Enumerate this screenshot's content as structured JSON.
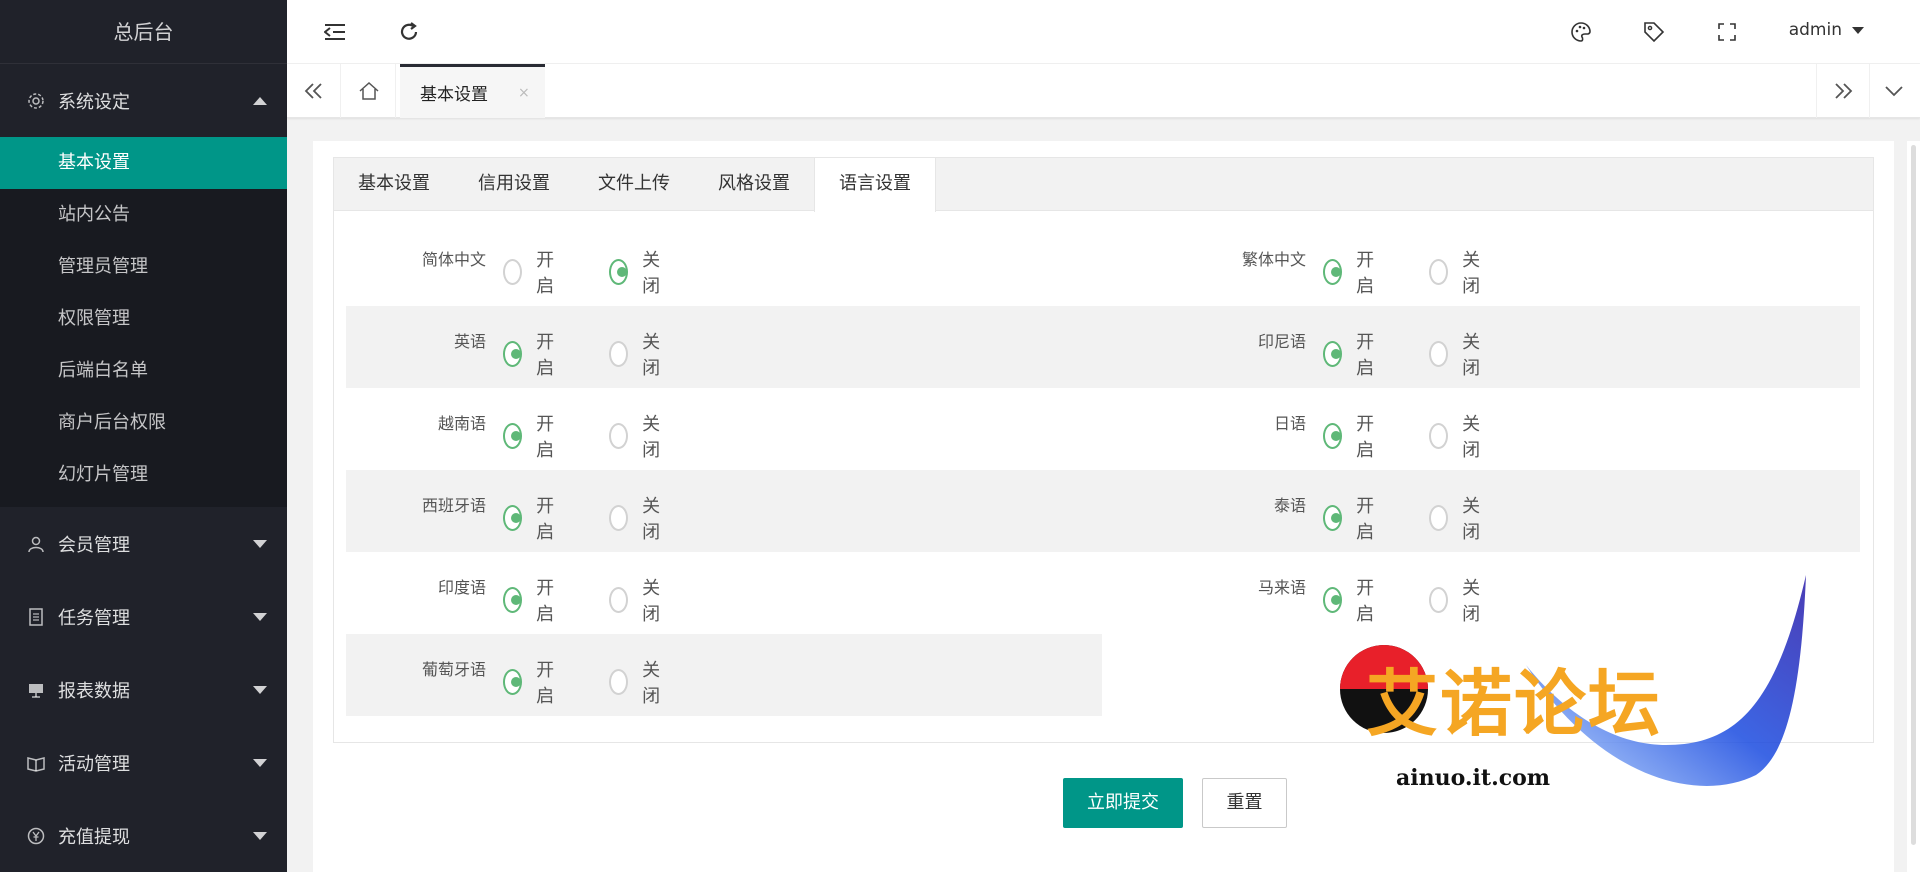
{
  "app": {
    "title": "总后台"
  },
  "sidebar": {
    "groups": [
      {
        "label": "系统设定",
        "icon": "gear-icon",
        "expanded": true,
        "items": [
          {
            "label": "基本设置",
            "active": true
          },
          {
            "label": "站内公告"
          },
          {
            "label": "管理员管理"
          },
          {
            "label": "权限管理"
          },
          {
            "label": "后端白名单"
          },
          {
            "label": "商户后台权限"
          },
          {
            "label": "幻灯片管理"
          }
        ]
      },
      {
        "label": "会员管理",
        "icon": "user-icon"
      },
      {
        "label": "任务管理",
        "icon": "document-icon"
      },
      {
        "label": "报表数据",
        "icon": "monitor-icon"
      },
      {
        "label": "活动管理",
        "icon": "book-icon"
      },
      {
        "label": "充值提现",
        "icon": "yen-icon"
      }
    ]
  },
  "topbar": {
    "user": "admin",
    "icons": [
      "collapse-menu-icon",
      "refresh-icon",
      "palette-icon",
      "tag-icon",
      "fullscreen-icon"
    ]
  },
  "tabbar": {
    "current_page": "基本设置",
    "close_symbol": "×"
  },
  "form": {
    "tabs": [
      {
        "label": "基本设置"
      },
      {
        "label": "信用设置"
      },
      {
        "label": "文件上传"
      },
      {
        "label": "风格设置"
      },
      {
        "label": "语言设置",
        "active": true
      }
    ],
    "option_on": "开启",
    "option_off": "关闭",
    "languages": [
      {
        "label": "简体中文",
        "on": false
      },
      {
        "label": "繁体中文",
        "on": true
      },
      {
        "label": "英语",
        "on": true
      },
      {
        "label": "印尼语",
        "on": true
      },
      {
        "label": "越南语",
        "on": true
      },
      {
        "label": "日语",
        "on": true
      },
      {
        "label": "西班牙语",
        "on": true
      },
      {
        "label": "泰语",
        "on": true
      },
      {
        "label": "印度语",
        "on": true
      },
      {
        "label": "马来语",
        "on": true
      },
      {
        "label": "葡萄牙语",
        "on": true
      }
    ],
    "submit_label": "立即提交",
    "reset_label": "重置"
  },
  "watermark": {
    "text": "艾诺论坛",
    "url": "ainuo.it.com"
  },
  "colors": {
    "sidebar_bg": "#20222a",
    "accent": "#009688",
    "radio_on": "#5fb878"
  }
}
